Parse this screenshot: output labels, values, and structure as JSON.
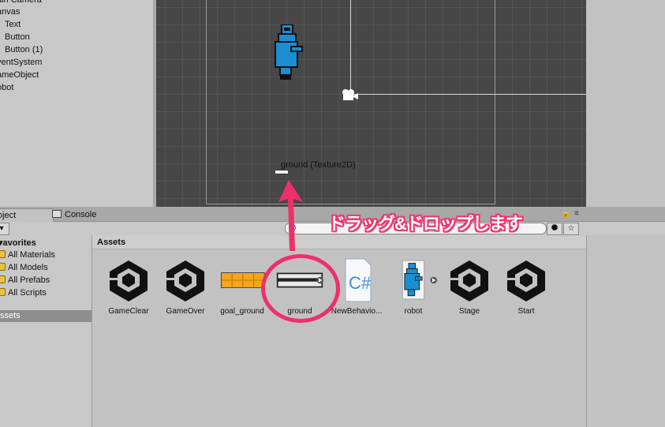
{
  "hierarchy": {
    "items": [
      "ain Camera",
      "anvas",
      "Text",
      "Button",
      "Button (1)",
      "ventSystem",
      "ameObject",
      "obot"
    ]
  },
  "scene": {
    "ground_label": "ground (Texture2D)",
    "camera_icon": "camera-gizmo-icon",
    "sprite_icon": "robot-sprite"
  },
  "tabs": {
    "project": "oject",
    "console": "Console"
  },
  "favorites": {
    "title": "avorites",
    "items": [
      "All Materials",
      "All Models",
      "All Prefabs",
      "All Scripts"
    ],
    "assets_root": "ssets"
  },
  "assets": {
    "header": "Assets",
    "items": [
      {
        "name": "GameClear",
        "icon": "unity-scene-icon"
      },
      {
        "name": "GameOver",
        "icon": "unity-scene-icon"
      },
      {
        "name": "goal_ground",
        "icon": "texture-thumbnail"
      },
      {
        "name": "ground",
        "icon": "texture-thumbnail"
      },
      {
        "name": "NewBehavio...",
        "icon": "csharp-script-icon"
      },
      {
        "name": "robot",
        "icon": "robot-sprite"
      },
      {
        "name": "Stage",
        "icon": "unity-scene-icon"
      },
      {
        "name": "Start",
        "icon": "unity-scene-icon"
      }
    ]
  },
  "annotation": {
    "text": "ドラッグ&ドロップします",
    "color": "#ee2f6b"
  }
}
